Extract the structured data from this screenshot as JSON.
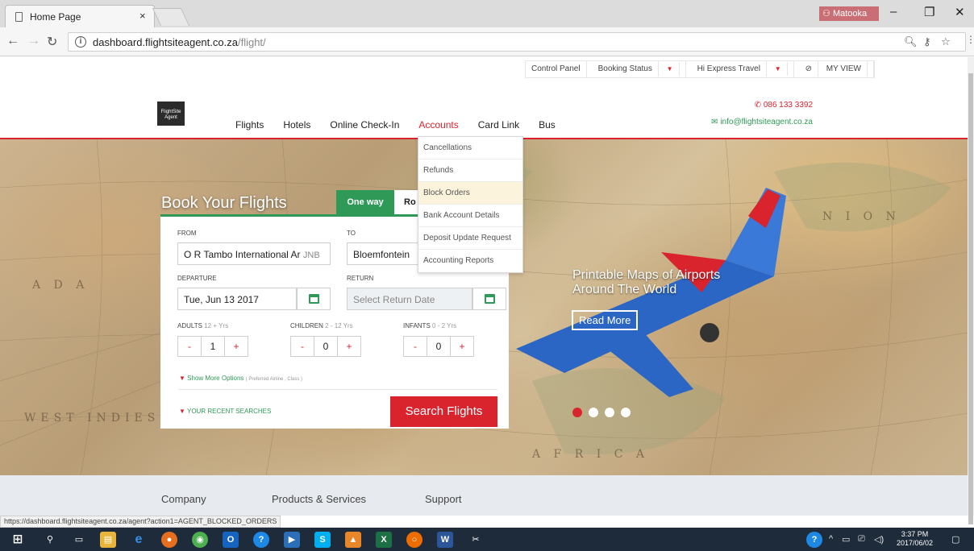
{
  "browser": {
    "tab_title": "Home Page",
    "tab_close": "×",
    "profile_name": "Matooka",
    "url_host": "dashboard.flightsiteagent.co.za",
    "url_path": "/flight/",
    "status_url": "https://dashboard.flightsiteagent.co.za/agent?action1=AGENT_BLOCKED_ORDERS"
  },
  "topnav": {
    "control_panel": "Control Panel",
    "booking_status": "Booking Status",
    "agency": "Hi Express Travel",
    "my_view": "MY VIEW"
  },
  "logo": {
    "text": "FlightSite Agent"
  },
  "mainnav": [
    "Flights",
    "Hotels",
    "Online Check-In",
    "Accounts",
    "Card Link",
    "Bus"
  ],
  "contact": {
    "phone": "086 133 3392",
    "email": "info@flightsiteagent.co.za"
  },
  "accounts_menu": [
    "Cancellations",
    "Refunds",
    "Block Orders",
    "Bank Account Details",
    "Deposit Update Request",
    "Accounting Reports"
  ],
  "booking": {
    "title": "Book Your Flights",
    "tab_oneway": "One way",
    "tab_round": "Ro",
    "from_label": "FROM",
    "from_value": "O R Tambo International Ar",
    "from_code": "JNB",
    "to_label": "TO",
    "to_value": "Bloemfontein",
    "departure_label": "DEPARTURE",
    "departure_value": "Tue, Jun 13 2017",
    "return_label": "RETURN",
    "return_placeholder": "Select Return Date",
    "adults_label": "ADULTS",
    "adults_sub": "12 + Yrs",
    "adults_value": "1",
    "children_label": "CHILDREN",
    "children_sub": "2 - 12 Yrs",
    "children_value": "0",
    "infants_label": "INFANTS",
    "infants_sub": "0 - 2 Yrs",
    "infants_value": "0",
    "minus": "-",
    "plus": "+",
    "more_options": "Show More Options",
    "more_options_sub": "( Preferred Airline , Class )",
    "recent": "YOUR RECENT SEARCHES",
    "search_button": "Search Flights"
  },
  "hero": {
    "headline_1": "Printable Maps of Airports",
    "headline_2": "Around The World",
    "cta": "Read More"
  },
  "footer": [
    "Company",
    "Products & Services",
    "Support"
  ],
  "taskbar": {
    "time": "3:37 PM",
    "date": "2017/06/02"
  },
  "colors": {
    "brand_red": "#d9232d",
    "brand_green": "#2f9a57"
  }
}
